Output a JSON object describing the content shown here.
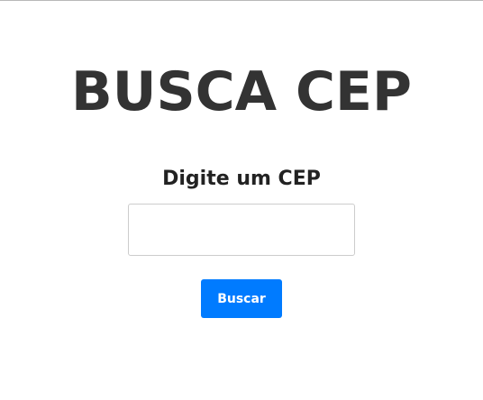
{
  "header": {
    "title": "BUSCA CEP"
  },
  "form": {
    "label": "Digite um CEP",
    "cep_value": "",
    "cep_placeholder": "",
    "search_label": "Buscar"
  },
  "colors": {
    "title_text": "#333333",
    "button_bg": "#007bff",
    "button_text": "#ffffff",
    "input_border": "#cccccc"
  }
}
